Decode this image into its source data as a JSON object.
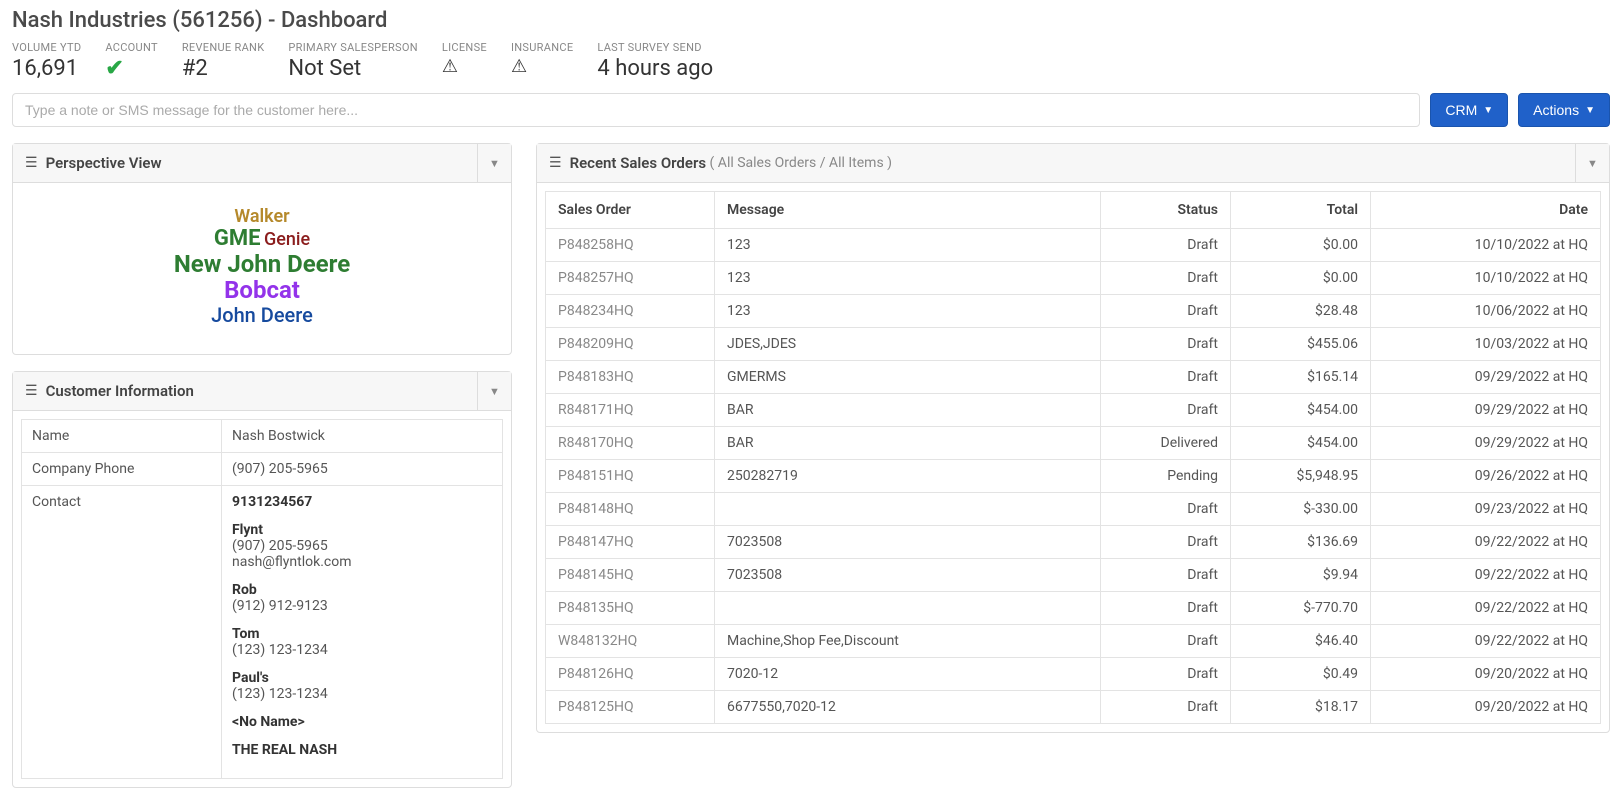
{
  "page_title": "Nash Industries (561256) - Dashboard",
  "stats": {
    "volume_ytd": {
      "label": "VOLUME YTD",
      "value": "16,691"
    },
    "account": {
      "label": "ACCOUNT",
      "value": "check"
    },
    "revenue_rank": {
      "label": "REVENUE RANK",
      "value": "#2"
    },
    "primary_salesperson": {
      "label": "PRIMARY SALESPERSON",
      "value": "Not Set"
    },
    "license": {
      "label": "LICENSE",
      "value": "warn"
    },
    "insurance": {
      "label": "INSURANCE",
      "value": "warn"
    },
    "last_survey": {
      "label": "LAST SURVEY SEND",
      "value": "4 hours ago"
    }
  },
  "note_placeholder": "Type a note or SMS message for the customer here...",
  "buttons": {
    "crm": "CRM",
    "actions": "Actions"
  },
  "panels": {
    "perspective": {
      "title": "Perspective View"
    },
    "customer_info": {
      "title": "Customer Information"
    },
    "recent_orders": {
      "title": "Recent Sales Orders",
      "subtitle": "( All Sales Orders / All Items )"
    }
  },
  "wordcloud": {
    "walker": "Walker",
    "gme": "GME",
    "genie": "Genie",
    "new_john_deere": "New John Deere",
    "bobcat": "Bobcat",
    "john_deere": "John Deere"
  },
  "customer_info": {
    "name_label": "Name",
    "name_value": "Nash Bostwick",
    "phone_label": "Company Phone",
    "phone_value": "(907) 205-5965",
    "contact_label": "Contact",
    "contacts": [
      {
        "name": "9131234567",
        "lines": []
      },
      {
        "name": "Flynt",
        "lines": [
          "(907) 205-5965",
          "nash@flyntlok.com"
        ]
      },
      {
        "name": "Rob",
        "lines": [
          "(912) 912-9123"
        ]
      },
      {
        "name": "Tom",
        "lines": [
          "(123) 123-1234"
        ]
      },
      {
        "name": "Paul's",
        "lines": [
          "(123) 123-1234"
        ]
      },
      {
        "name": "<No Name>",
        "lines": []
      },
      {
        "name": "THE REAL NASH",
        "lines": []
      }
    ]
  },
  "orders_columns": {
    "sales_order": "Sales Order",
    "message": "Message",
    "status": "Status",
    "total": "Total",
    "date": "Date"
  },
  "orders": [
    {
      "so": "P848258HQ",
      "msg": "123",
      "status": "Draft",
      "total": "$0.00",
      "date": "10/10/2022 at HQ"
    },
    {
      "so": "P848257HQ",
      "msg": "123",
      "status": "Draft",
      "total": "$0.00",
      "date": "10/10/2022 at HQ"
    },
    {
      "so": "P848234HQ",
      "msg": "123",
      "status": "Draft",
      "total": "$28.48",
      "date": "10/06/2022 at HQ"
    },
    {
      "so": "P848209HQ",
      "msg": "JDES,JDES",
      "status": "Draft",
      "total": "$455.06",
      "date": "10/03/2022 at HQ"
    },
    {
      "so": "P848183HQ",
      "msg": "GMERMS",
      "status": "Draft",
      "total": "$165.14",
      "date": "09/29/2022 at HQ"
    },
    {
      "so": "R848171HQ",
      "msg": "BAR",
      "status": "Draft",
      "total": "$454.00",
      "date": "09/29/2022 at HQ"
    },
    {
      "so": "R848170HQ",
      "msg": "BAR",
      "status": "Delivered",
      "total": "$454.00",
      "date": "09/29/2022 at HQ"
    },
    {
      "so": "P848151HQ",
      "msg": "250282719",
      "status": "Pending",
      "total": "$5,948.95",
      "date": "09/26/2022 at HQ"
    },
    {
      "so": "P848148HQ",
      "msg": "",
      "status": "Draft",
      "total": "$-330.00",
      "date": "09/23/2022 at HQ"
    },
    {
      "so": "P848147HQ",
      "msg": "7023508",
      "status": "Draft",
      "total": "$136.69",
      "date": "09/22/2022 at HQ"
    },
    {
      "so": "P848145HQ",
      "msg": "7023508",
      "status": "Draft",
      "total": "$9.94",
      "date": "09/22/2022 at HQ"
    },
    {
      "so": "P848135HQ",
      "msg": "",
      "status": "Draft",
      "total": "$-770.70",
      "date": "09/22/2022 at HQ"
    },
    {
      "so": "W848132HQ",
      "msg": "Machine,Shop Fee,Discount",
      "status": "Draft",
      "total": "$46.40",
      "date": "09/22/2022 at HQ"
    },
    {
      "so": "P848126HQ",
      "msg": "7020-12",
      "status": "Draft",
      "total": "$0.49",
      "date": "09/20/2022 at HQ"
    },
    {
      "so": "P848125HQ",
      "msg": "6677550,7020-12",
      "status": "Draft",
      "total": "$18.17",
      "date": "09/20/2022 at HQ"
    }
  ]
}
